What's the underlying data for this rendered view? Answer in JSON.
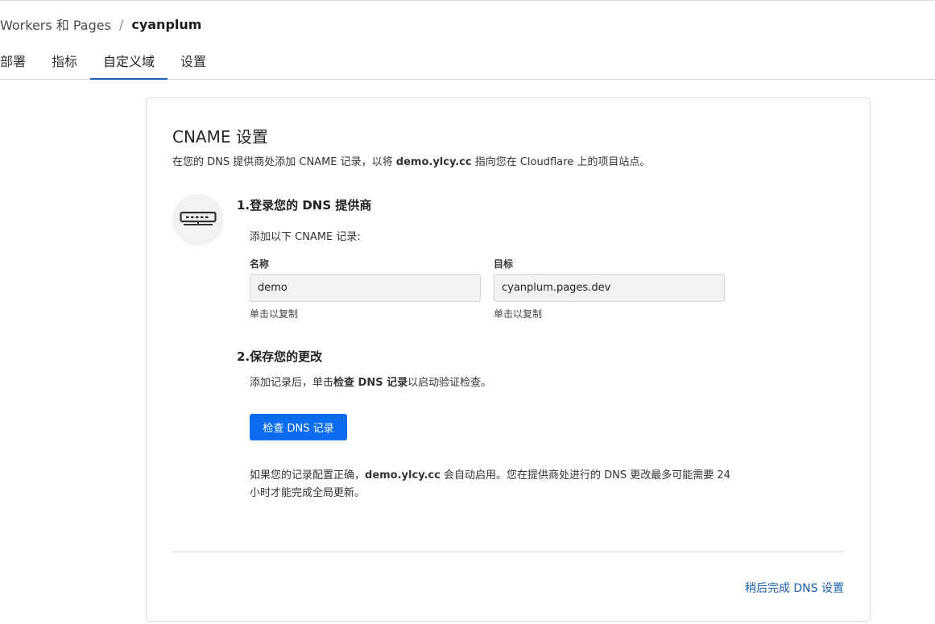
{
  "breadcrumb": {
    "parent": "Workers 和 Pages",
    "separator": "/",
    "current": "cyanplum"
  },
  "tabs": [
    {
      "label": "部署"
    },
    {
      "label": "指标"
    },
    {
      "label": "自定义域"
    },
    {
      "label": "设置"
    }
  ],
  "active_tab": "自定义域",
  "card": {
    "title": "CNAME 设置",
    "desc_prefix": "在您的 DNS 提供商处添加 CNAME 记录，以将 ",
    "desc_domain": "demo.ylcy.cc",
    "desc_suffix": " 指向您在 Cloudflare 上的项目站点。",
    "icon": "router-icon",
    "step1": {
      "title": "1.登录您的 DNS 提供商",
      "subtitle": "添加以下 CNAME 记录:",
      "name_label": "名称",
      "name_value": "demo",
      "name_hint": "单击以复制",
      "target_label": "目标",
      "target_value": "cyanplum.pages.dev",
      "target_hint": "单击以复制"
    },
    "step2": {
      "title": "2.保存您的更改",
      "sub_prefix": "添加记录后，单击",
      "sub_bold": "检查 DNS 记录",
      "sub_suffix": "以启动验证检查。",
      "button": "检查 DNS 记录",
      "note_prefix": "如果您的记录配置正确，",
      "note_domain": "demo.ylcy.cc",
      "note_suffix": " 会自动启用。您在提供商处进行的 DNS 更改最多可能需要 24 小时才能完成全局更新。"
    },
    "later_link": "稍后完成 DNS 设置"
  },
  "colors": {
    "accent": "#0b6cf0",
    "link": "#1b5fb0",
    "field_bg": "#f2f2f2"
  }
}
